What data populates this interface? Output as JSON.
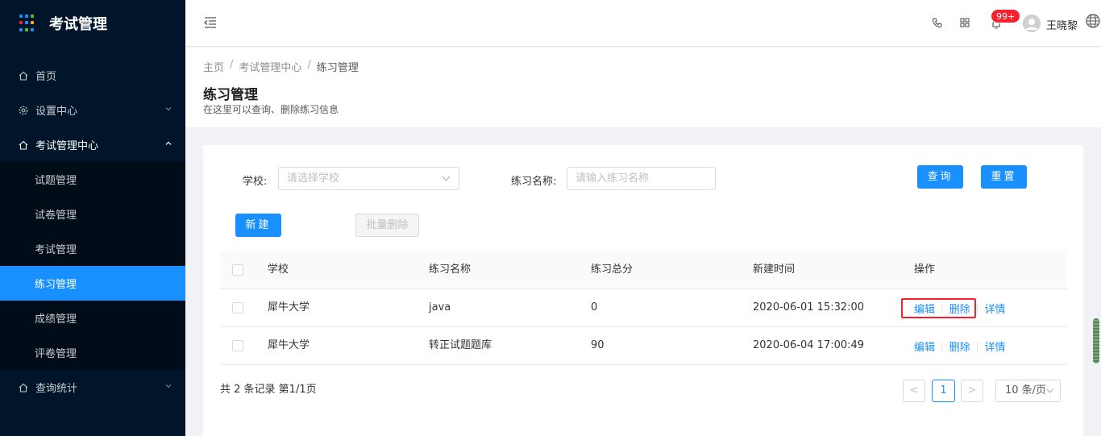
{
  "sidebar": {
    "brand_title": "考试管理",
    "logo_colors": [
      "#1890ff",
      "#1890ff",
      "#52c41a",
      "#f5222d",
      "#1890ff",
      "#faad14",
      "#1890ff",
      "#52c41a",
      "#1890ff"
    ],
    "items": [
      {
        "label": "首页",
        "icon": "home-icon"
      },
      {
        "label": "设置中心",
        "icon": "gear-icon"
      },
      {
        "label": "考试管理中心",
        "icon": "home-icon"
      },
      {
        "label": "查询统计",
        "icon": "home-icon"
      }
    ],
    "submenu": [
      {
        "label": "试题管理"
      },
      {
        "label": "试卷管理"
      },
      {
        "label": "考试管理"
      },
      {
        "label": "练习管理"
      },
      {
        "label": "成绩管理"
      },
      {
        "label": "评卷管理"
      }
    ],
    "active_color": "#1890ff"
  },
  "topbar": {
    "badge": "99+",
    "username": "王晓黎"
  },
  "header": {
    "breadcrumb": [
      "主页",
      "考试管理中心",
      "练习管理"
    ],
    "breadcrumb_sep": "/",
    "title": "练习管理",
    "description": "在这里可以查询、删除练习信息"
  },
  "filters": {
    "school_label": "学校:",
    "school_placeholder": "请选择学校",
    "name_label": "练习名称:",
    "name_placeholder": "请输入练习名称",
    "query_button": "查询",
    "reset_button": "重置"
  },
  "actions": {
    "new_button": "新建",
    "batch_delete_button": "批量删除"
  },
  "table": {
    "columns": [
      "学校",
      "练习名称",
      "练习总分",
      "新建时间",
      "操作"
    ],
    "rows": [
      {
        "school": "犀牛大学",
        "name": "java",
        "score": "0",
        "created": "2020-06-01 15:32:00"
      },
      {
        "school": "犀牛大学",
        "name": "转正试题题库",
        "score": "90",
        "created": "2020-06-04 17:00:49"
      }
    ],
    "ops": {
      "edit": "编辑",
      "delete": "删除",
      "detail": "详情",
      "sep": "|"
    }
  },
  "pagination": {
    "summary": "共 2 条记录 第1/1页",
    "prev": "<",
    "current": "1",
    "next": ">",
    "page_size": "10 条/页"
  }
}
